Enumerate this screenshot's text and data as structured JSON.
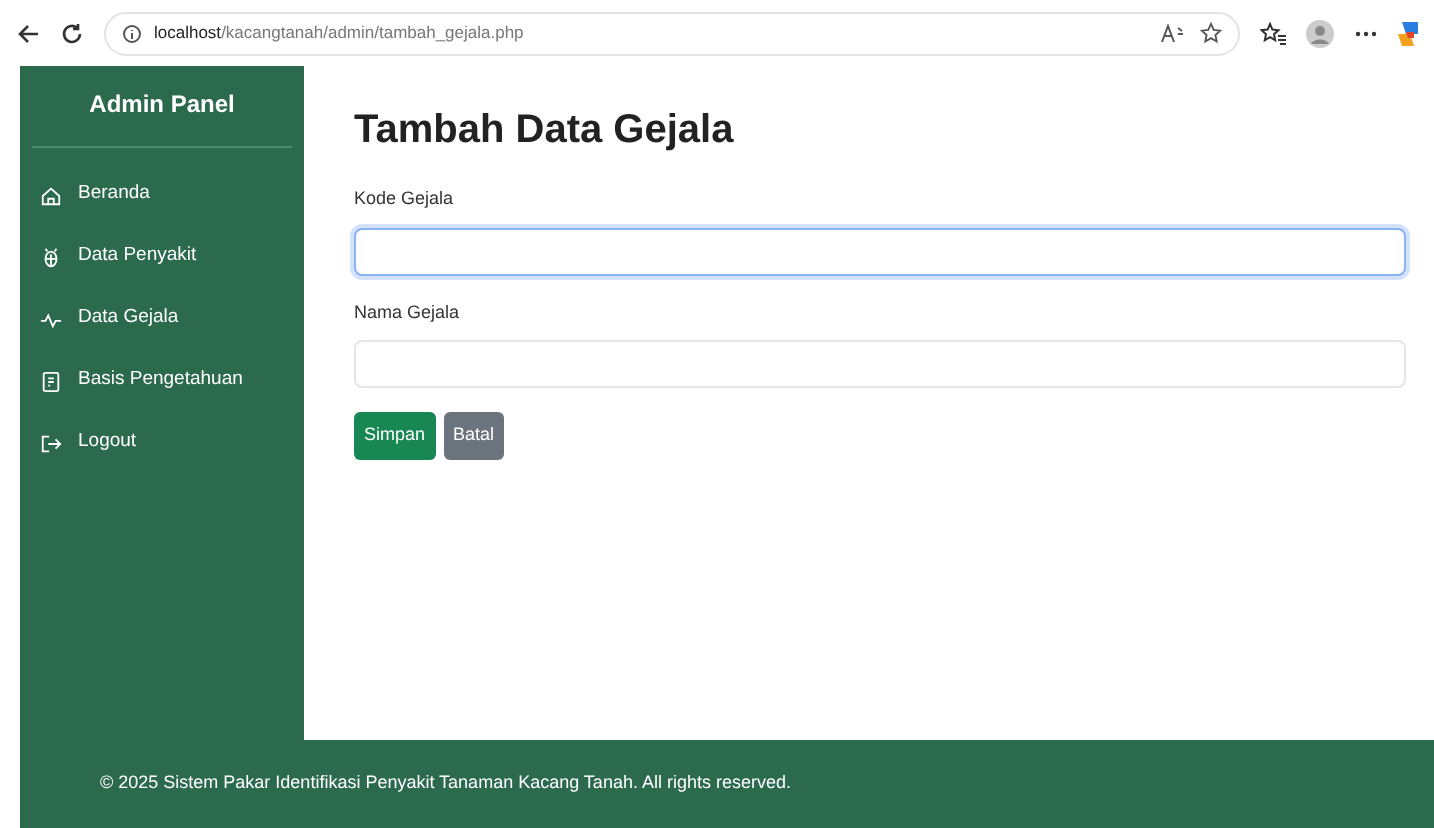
{
  "browser": {
    "url_host": "localhost",
    "url_path": "/kacangtanah/admin/tambah_gejala.php"
  },
  "sidebar": {
    "title": "Admin Panel",
    "items": [
      {
        "label": "Beranda",
        "kind": "home"
      },
      {
        "label": "Data Penyakit",
        "kind": "disease"
      },
      {
        "label": "Data Gejala",
        "kind": "pulse"
      },
      {
        "label": "Basis Pengetahuan",
        "kind": "document"
      },
      {
        "label": "Logout",
        "kind": "logout"
      }
    ]
  },
  "form": {
    "title": "Tambah Data Gejala",
    "fields": [
      {
        "label": "Kode Gejala",
        "focused": true
      },
      {
        "label": "Nama Gejala",
        "focused": false
      }
    ],
    "buttons": [
      {
        "label": "Simpan",
        "kind": "primary"
      },
      {
        "label": "Batal",
        "kind": "secondary"
      }
    ]
  },
  "footer": "© 2025 Sistem Pakar Identifikasi Penyakit Tanaman Kacang Tanah. All rights reserved."
}
